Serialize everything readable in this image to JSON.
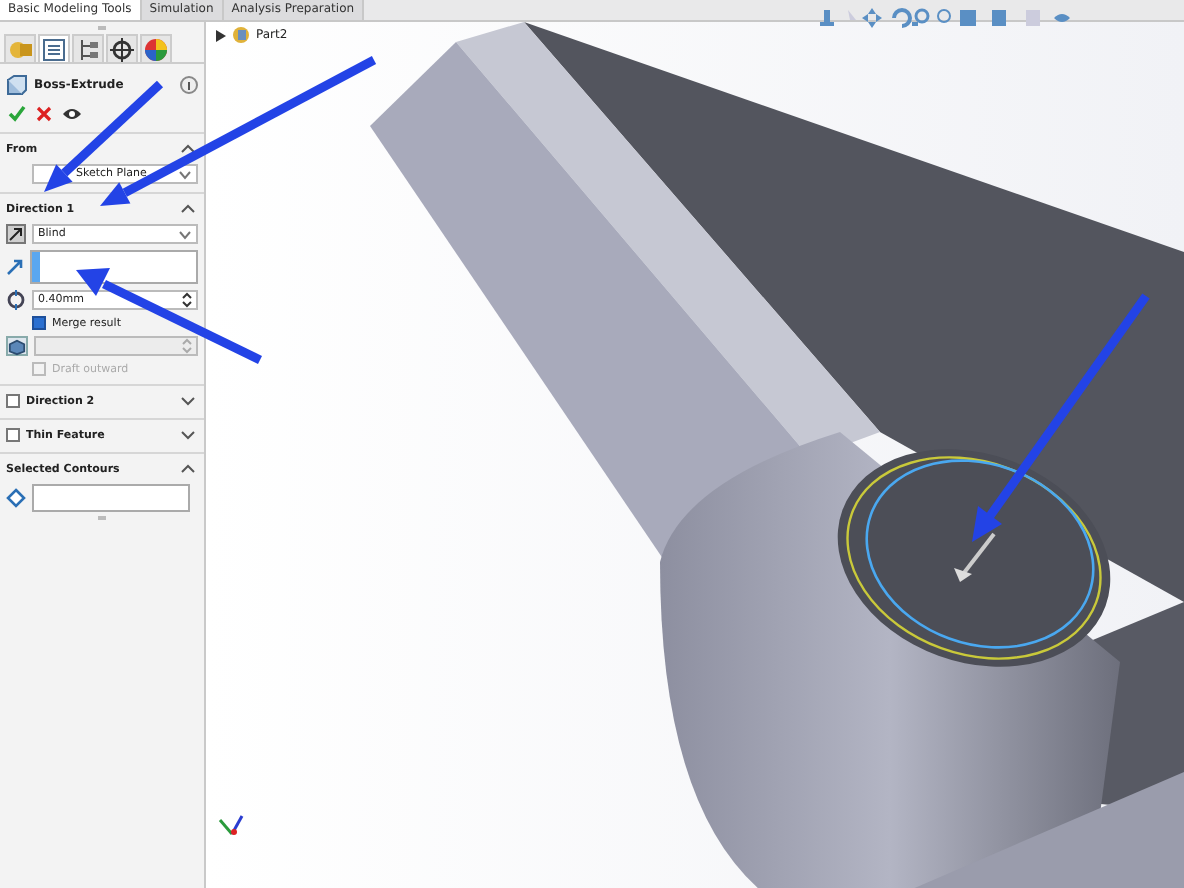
{
  "tabs": [
    {
      "label": "Basic Modeling Tools",
      "selected": true
    },
    {
      "label": "Simulation",
      "selected": false
    },
    {
      "label": "Analysis Preparation",
      "selected": false
    }
  ],
  "panel_tabs": [
    {
      "kind": "feature",
      "selected": false
    },
    {
      "kind": "property",
      "selected": true
    },
    {
      "kind": "config",
      "selected": false
    },
    {
      "kind": "dimxpert",
      "selected": false
    },
    {
      "kind": "display",
      "selected": false
    }
  ],
  "feature": {
    "title": "Boss-Extrude"
  },
  "sections": [
    {
      "kind": "from",
      "title": "From",
      "expanded": true,
      "start": "Sketch Plane"
    },
    {
      "kind": "direction",
      "title": "Direction 1",
      "expanded": true,
      "end_condition": "Blind",
      "depth": "0.40mm",
      "merge": {
        "label": "Merge result",
        "checked": true
      },
      "draft": {
        "label": "Draft outward",
        "checked": false,
        "disabled": true
      }
    },
    {
      "kind": "option",
      "title": "Direction 2",
      "checked": false,
      "expanded": false
    },
    {
      "kind": "option",
      "title": "Thin Feature",
      "checked": false,
      "expanded": false
    },
    {
      "kind": "contours",
      "title": "Selected Contours",
      "expanded": true
    }
  ],
  "tree": {
    "part": "Part2"
  }
}
